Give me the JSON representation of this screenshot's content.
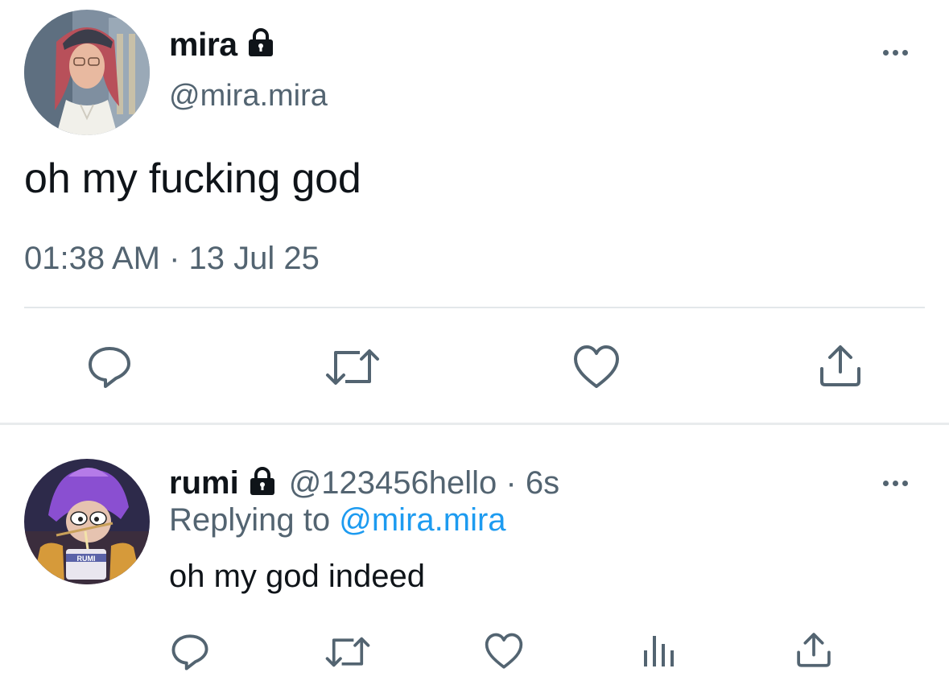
{
  "main_tweet": {
    "display_name": "mira",
    "handle": "@mira.mira",
    "text": "oh my fucking god",
    "timestamp": "01:38 AM · 13 Jul 25",
    "avatar": "girl-with-cap-avatar",
    "protected_icon": "lock-icon",
    "actions": [
      "reply-icon",
      "retweet-icon",
      "like-icon",
      "share-icon"
    ]
  },
  "reply_tweet": {
    "display_name": "rumi",
    "handle": "@123456hello",
    "handle_time": "@123456hello · 6s",
    "relative_time": "6s",
    "replying_label": "Replying to",
    "replying_handle": "@mira.mira",
    "text": "oh my god indeed",
    "avatar": "purple-hair-eating-noodles-avatar",
    "avatar_cup_text": "RUMI",
    "protected_icon": "lock-icon",
    "actions": [
      "reply-icon",
      "retweet-icon",
      "like-icon",
      "analytics-icon",
      "share-icon"
    ]
  },
  "colors": {
    "text_primary": "#0f1419",
    "text_secondary": "#536471",
    "link": "#1d9bf0",
    "divider": "#e3e7ea"
  }
}
